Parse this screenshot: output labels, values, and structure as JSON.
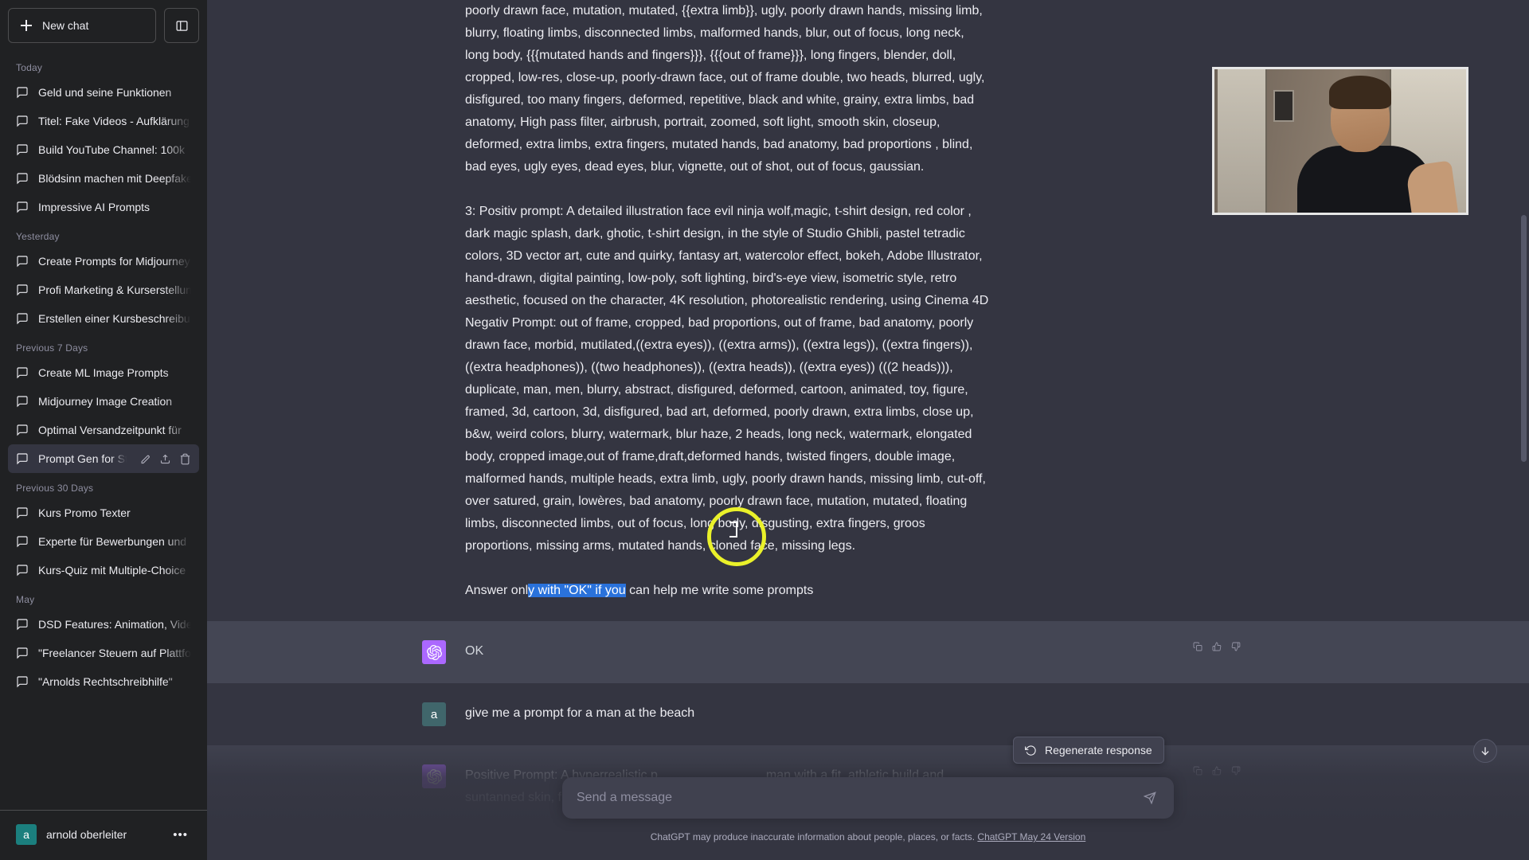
{
  "sidebar": {
    "new_chat_label": "New chat",
    "collapse_tooltip": "Collapse sidebar",
    "groups": [
      {
        "label": "Today",
        "items": [
          "Geld und seine Funktionen",
          "Titel: Fake Videos - Aufklärung",
          "Build YouTube Channel: 100k",
          "Blödsinn machen mit Deepfakes",
          "Impressive AI Prompts"
        ]
      },
      {
        "label": "Yesterday",
        "items": [
          "Create Prompts for Midjourney",
          "Profi Marketing & Kurserstellung",
          "Erstellen einer Kursbeschreibung"
        ]
      },
      {
        "label": "Previous 7 Days",
        "items": [
          "Create ML Image Prompts",
          "Midjourney Image Creation",
          "Optimal Versandzeitpunkt für",
          "Prompt Gen for Stable Diffusion"
        ]
      },
      {
        "label": "Previous 30 Days",
        "items": [
          "Kurs Promo Texter",
          "Experte für Bewerbungen und",
          "Kurs-Quiz mit Multiple-Choice"
        ]
      },
      {
        "label": "May",
        "items": [
          "DSD Features: Animation, Video",
          "\"Freelancer Steuern auf Plattform",
          "\"Arnolds Rechtschreibhilfe\""
        ]
      }
    ],
    "active_item": "Prompt Gen for Stable Diffusion",
    "user": {
      "initial": "a",
      "name": "arnold oberleiter",
      "menu_dots": "•••"
    }
  },
  "conversation": {
    "messages": [
      {
        "role": "user",
        "avatar_initial": "a",
        "paragraphs": [
          "poorly drawn face, mutation, mutated, {{extra limb}}, ugly, poorly drawn hands, missing limb, blurry, floating limbs, disconnected limbs, malformed hands, blur, out of focus, long neck, long body, {{{mutated hands and fingers}}}, {{{out of frame}}}, long fingers, blender, doll, cropped, low-res, close-up, poorly-drawn face, out of frame double, two heads, blurred, ugly, disfigured, too many fingers, deformed, repetitive, black and white, grainy, extra limbs, bad anatomy, High pass filter, airbrush, portrait, zoomed, soft light, smooth skin, closeup, deformed, extra limbs, extra fingers, mutated hands, bad anatomy, bad proportions , blind, bad eyes, ugly eyes, dead eyes, blur, vignette, out of shot, out of focus, gaussian.",
          "3: Positiv prompt: A detailed illustration face evil ninja wolf,magic, t-shirt design, red color , dark magic splash, dark, ghotic, t-shirt design, in the style of Studio Ghibli, pastel tetradic colors, 3D vector art, cute and quirky, fantasy art, watercolor effect, bokeh, Adobe Illustrator, hand-drawn, digital painting, low-poly, soft lighting, bird's-eye view, isometric style, retro aesthetic, focused on the character, 4K resolution, photorealistic rendering, using Cinema 4D",
          "Negativ Prompt: out of frame, cropped, bad proportions, out of frame, bad anatomy, poorly drawn face, morbid, mutilated,((extra eyes)), ((extra arms)), ((extra legs)), ((extra fingers)), ((extra headphones)), ((two headphones)), ((extra heads)), ((extra eyes)) (((2 heads))), duplicate, man, men, blurry, abstract, disfigured, deformed, cartoon, animated, toy, figure, framed, 3d, cartoon, 3d, disfigured, bad art, deformed, poorly drawn, extra limbs, close up, b&w, weird colors, blurry, watermark, blur haze, 2 heads, long neck, watermark, elongated body, cropped image,out of frame,draft,deformed hands, twisted fingers, double image, malformed hands, multiple heads, extra limb, ugly, poorly drawn hands, missing limb, cut-off, over satured, grain, lowères, bad anatomy, poorly drawn face, mutation, mutated, floating limbs, disconnected limbs, out of focus, long body, disgusting, extra fingers, groos proportions, missing arms, mutated hands, cloned face, missing legs."
        ],
        "final_line_prefix": "Answer onl",
        "final_line_selected": "y with \"OK\" if you",
        "final_line_suffix": " can help me write some prompts"
      },
      {
        "role": "assistant",
        "text": "OK"
      },
      {
        "role": "user",
        "avatar_initial": "a",
        "text": "give me a prompt for a man at the beach"
      },
      {
        "role": "assistant",
        "text_line1": "Positive Prompt: A hyperrealistic p",
        "text_line1b": "man with a fit, athletic build and",
        "text_line2": "suntanned skin, full body portrait at a beach during sunset, impeccably detailed face"
      }
    ],
    "action_icons": [
      "copy-icon",
      "thumbs-up-icon",
      "thumbs-down-icon"
    ]
  },
  "regenerate": {
    "label": "Regenerate response",
    "icon": "refresh-icon"
  },
  "composer": {
    "placeholder": "Send a message",
    "value": "",
    "send_icon": "send-icon"
  },
  "footer": {
    "disclaimer": "ChatGPT may produce inaccurate information about people, places, or facts.",
    "version_link": "ChatGPT May 24 Version"
  },
  "scroll_down": {
    "icon": "arrow-down-icon"
  },
  "colors": {
    "sidebar_bg": "#202123",
    "main_bg": "#343541",
    "assistant_bg": "#444654",
    "bot_avatar": "#ab68ff",
    "user_avatar": "#40666b",
    "selection": "#2a72db",
    "cursor_ring": "#eaf12a"
  }
}
